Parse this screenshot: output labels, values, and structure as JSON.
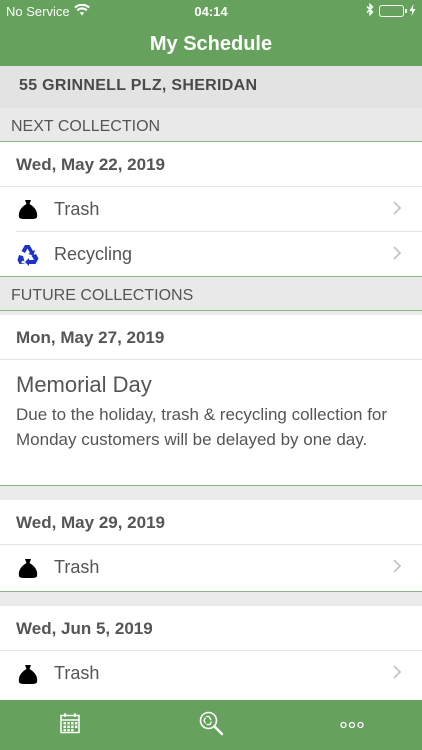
{
  "status_bar": {
    "carrier": "No Service",
    "time": "04:14",
    "icons": [
      "wifi-icon",
      "bluetooth-icon",
      "battery-icon",
      "charging-icon"
    ]
  },
  "header": {
    "title": "My Schedule"
  },
  "address": "55 GRINNELL PLZ, SHERIDAN",
  "next_collection": {
    "section_title": "NEXT COLLECTION",
    "date": "Wed, May 22, 2019",
    "items": [
      {
        "label": "Trash",
        "icon": "trash-bag-icon"
      },
      {
        "label": "Recycling",
        "icon": "recycling-icon"
      }
    ]
  },
  "future_collections": {
    "section_title": "FUTURE COLLECTIONS",
    "entries": [
      {
        "date": "Mon, May 27, 2019",
        "holiday_title": "Memorial Day",
        "holiday_desc": "Due to the holiday, trash & recycling collection for Monday customers will be delayed by one day."
      },
      {
        "date": "Wed, May 29, 2019",
        "items": [
          {
            "label": "Trash",
            "icon": "trash-bag-icon"
          }
        ]
      },
      {
        "date": "Wed, Jun 5, 2019",
        "items": [
          {
            "label": "Trash",
            "icon": "trash-bag-icon"
          }
        ]
      }
    ]
  },
  "tab_bar": {
    "tabs": [
      {
        "icon": "calendar-icon"
      },
      {
        "icon": "search-recycle-icon"
      },
      {
        "icon": "more-icon"
      }
    ]
  },
  "colors": {
    "brand_green": "#66a25e",
    "divider_green": "#8cb885",
    "recycle_blue": "#1c32c8"
  }
}
